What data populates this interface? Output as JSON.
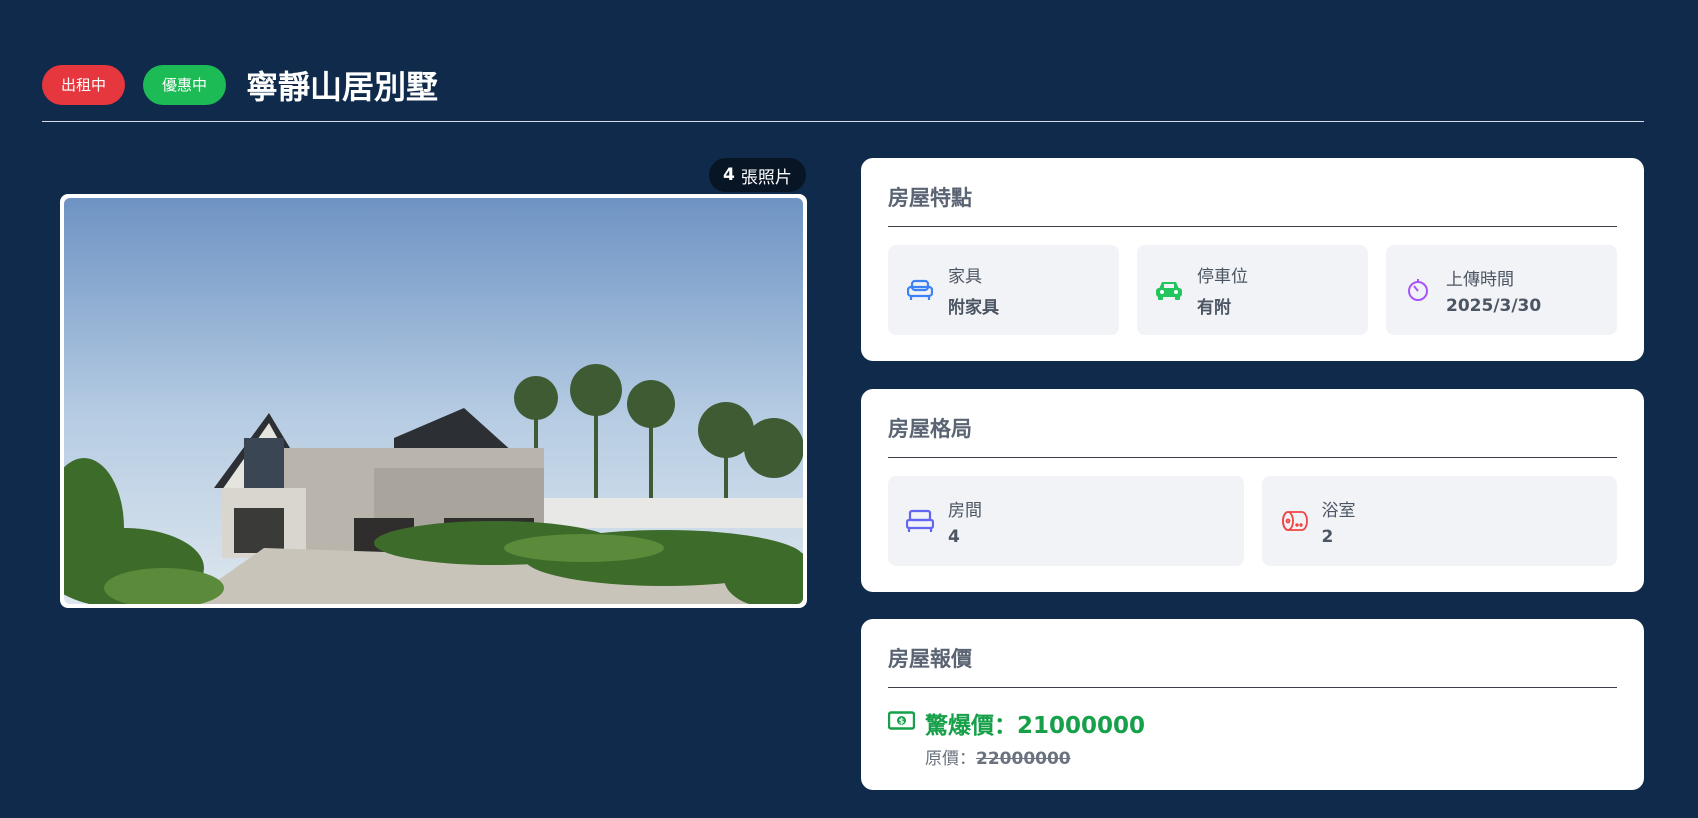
{
  "header": {
    "status_badge": "出租中",
    "discount_badge": "優惠中",
    "title": "寧靜山居別墅"
  },
  "gallery": {
    "photo_count_num": "4",
    "photo_count_label": "張照片",
    "photo_alt": ""
  },
  "features": {
    "title": "房屋特點",
    "items": [
      {
        "label": "家具",
        "value": "附家具",
        "icon": "sofa-icon",
        "color": "#3b82f6"
      },
      {
        "label": "停車位",
        "value": "有附",
        "icon": "car-icon",
        "color": "#22c55e"
      },
      {
        "label": "上傳時間",
        "value": "2025/3/30",
        "icon": "timer-icon",
        "color": "#a855f7"
      }
    ]
  },
  "layout": {
    "title": "房屋格局",
    "items": [
      {
        "label": "房間",
        "value": "4",
        "icon": "bed-icon",
        "color": "#6366f1"
      },
      {
        "label": "浴室",
        "value": "2",
        "icon": "toilet-paper-icon",
        "color": "#ef4444"
      }
    ]
  },
  "pricing": {
    "title": "房屋報價",
    "special_label": "驚爆價：",
    "special_price": "21000000",
    "original_label": "原價：",
    "original_price": "22000000",
    "icon": "money-bill-icon",
    "color": "#17a04a"
  }
}
